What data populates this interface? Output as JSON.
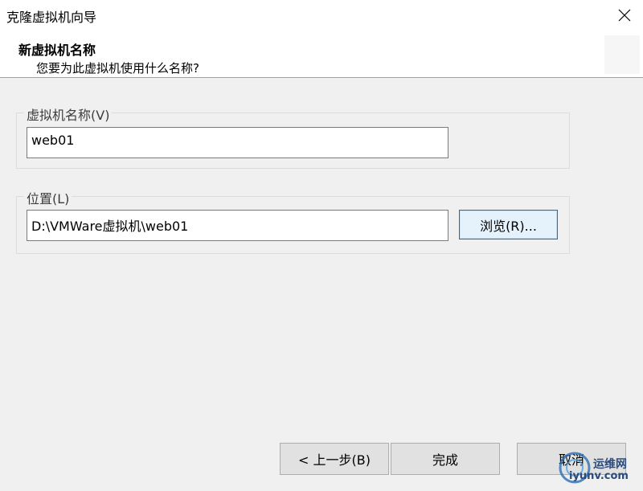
{
  "window": {
    "title": "克隆虚拟机向导"
  },
  "header": {
    "title": "新虚拟机名称",
    "subtitle": "您要为此虚拟机使用什么名称?"
  },
  "name_group": {
    "label": "虚拟机名称(V)",
    "value": "web01"
  },
  "location_group": {
    "label": "位置(L)",
    "value": "D:\\VMWare虚拟机\\web01",
    "browse_label": "浏览(R)..."
  },
  "footer": {
    "back_label": "< 上一步(B)",
    "finish_label": "完成",
    "cancel_label": "取消"
  },
  "watermark": {
    "line1": "运维网",
    "line2": "iyunv.com"
  },
  "colors": {
    "focus_border": "#0078d7",
    "button_bg": "#e1e1e1",
    "window_bg": "#f0f0f0"
  }
}
